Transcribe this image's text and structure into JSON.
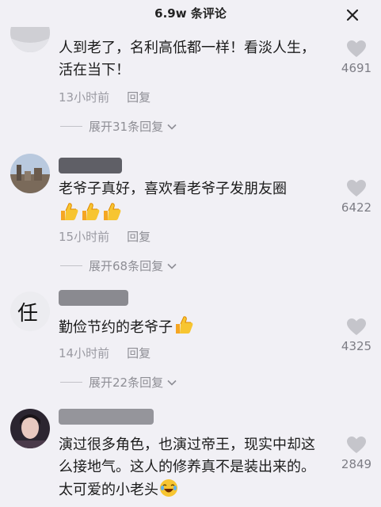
{
  "header": {
    "title": "6.9w 条评论"
  },
  "comments": [
    {
      "text": "人到老了，名利高低都一样！看淡人生，活在当下！",
      "time": "13小时前",
      "reply_label": "回复",
      "expand_label": "展开31条回复",
      "likes": "4691"
    },
    {
      "text": "老爷子真好，喜欢看老爷子发朋友圈",
      "time": "15小时前",
      "reply_label": "回复",
      "expand_label": "展开68条回复",
      "likes": "6422",
      "emoji": [
        "thumbs-up",
        "thumbs-up",
        "thumbs-up"
      ]
    },
    {
      "avatar_char": "任",
      "text": "勤俭节约的老爷子",
      "time": "14小时前",
      "reply_label": "回复",
      "expand_label": "展开22条回复",
      "likes": "4325",
      "emoji": [
        "thumbs-up"
      ]
    },
    {
      "text": "演过很多角色，也演过帝王，现实中却这么接地气。这人的修养真不是装出来的。太可爱的小老头",
      "likes": "2849",
      "emoji": [
        "laughing-face"
      ]
    }
  ]
}
